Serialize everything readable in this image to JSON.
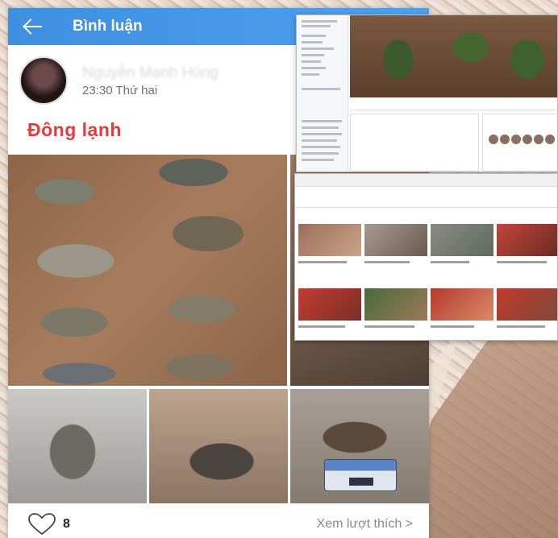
{
  "header": {
    "title": "Bình luận"
  },
  "post": {
    "author_name": "Nguyễn Mạnh Hùng",
    "timestamp": "23:30 Thứ hai",
    "text": "Đông lạnh"
  },
  "reactions": {
    "like_count": "8",
    "view_likes_label": "Xem lượt thích >"
  },
  "colors": {
    "header_blue": "#4a9aea",
    "post_text_red": "#e43b3b"
  },
  "icons": {
    "back": "arrow-left-icon",
    "like": "heart-outline-icon"
  }
}
